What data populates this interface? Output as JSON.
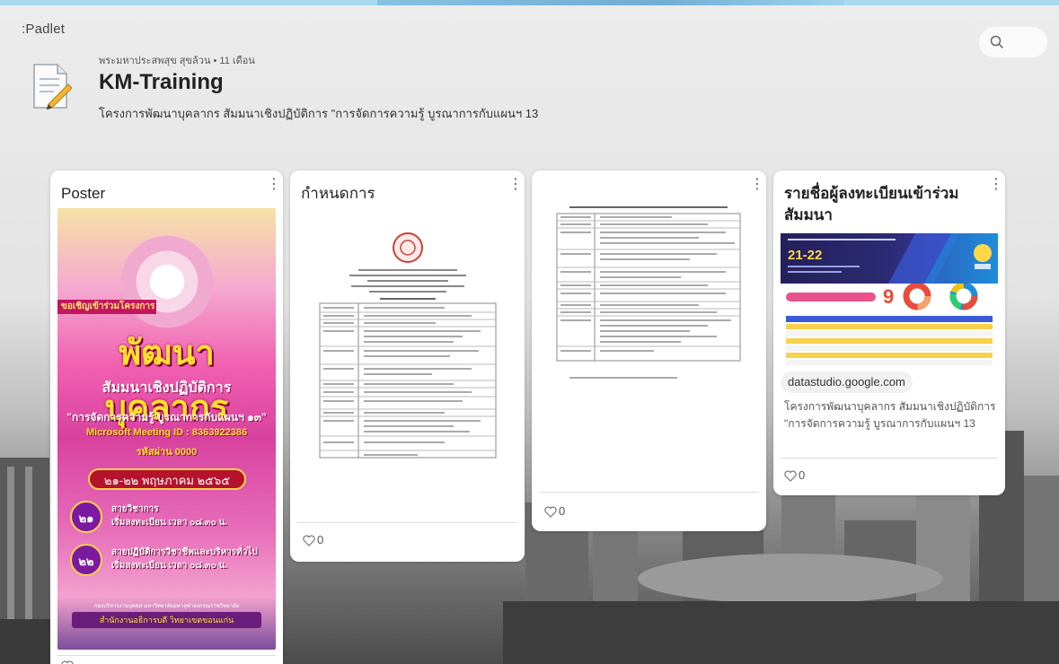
{
  "app": {
    "brand": ":Padlet"
  },
  "board": {
    "author_meta": "พระมหาประสพสุข สุขล้วน • 11 เดือน",
    "title": "KM-Training",
    "description": "โครงการพัฒนาบุคลากร สัมมนาเชิงปฏิบัติการ \"การจัดการความรู้ บูรณาการกับแผนฯ 13"
  },
  "search": {
    "icon": "search-icon"
  },
  "cards": [
    {
      "title": "Poster",
      "poster": {
        "ribbon": "ขอเชิญเข้าร่วมโครงการ",
        "headline": "พัฒนาบุคลากร",
        "subtitle": "สัมมนาเชิงปฏิบัติการ",
        "topic": "\"การจัดการความรู้ บูรณาการกับแผนฯ ๑๓\"",
        "meeting": "Microsoft Meeting ID : 8363922386",
        "passcode": "รหัสผ่าน 0000",
        "date": "๒๑-๒๒ พฤษภาคม ๒๕๖๕",
        "rows": [
          {
            "badge": "๒๑",
            "line1": "สายวิชาการ",
            "line2": "เริ่มลงทะเบียน เวลา ๐๘.๓๐ น."
          },
          {
            "badge": "๒๒",
            "line1": "สายปฏิบัติการวิชาชีพและบริหารทั่วไป",
            "line2": "เริ่มลงทะเบียน เวลา ๐๘.๓๐ น."
          }
        ],
        "footer_small": "กองบริหารงานบุคคล มหาวิทยาลัยมหาจุฬาลงกรณราชวิทยาลัย",
        "footer_bar": "สำนักงานอธิการบดี วิทยาเขตขอนแก่น"
      },
      "likes": ""
    },
    {
      "title": "กำหนดการ",
      "likes": "0"
    },
    {
      "title": "",
      "likes": "0"
    },
    {
      "title": "รายชื่อผู้ลงทะเบียนเข้าร่วมสัมมนา",
      "banner_text": "21-22",
      "stat": "9",
      "link": "datastudio.google.com",
      "description": "โครงการพัฒนาบุคลากร สัมมนาเชิงปฏิบัติการ \"การจัดการความรู้ บูรณาการกับแผนฯ 13",
      "likes": "0"
    }
  ],
  "colors": {
    "poster_pink": "#f05fb0",
    "poster_gold": "#ffe12e",
    "banner_navy": "#24205a",
    "donut_red": "#e74c3c",
    "donut_blue": "#1f8ed8"
  }
}
